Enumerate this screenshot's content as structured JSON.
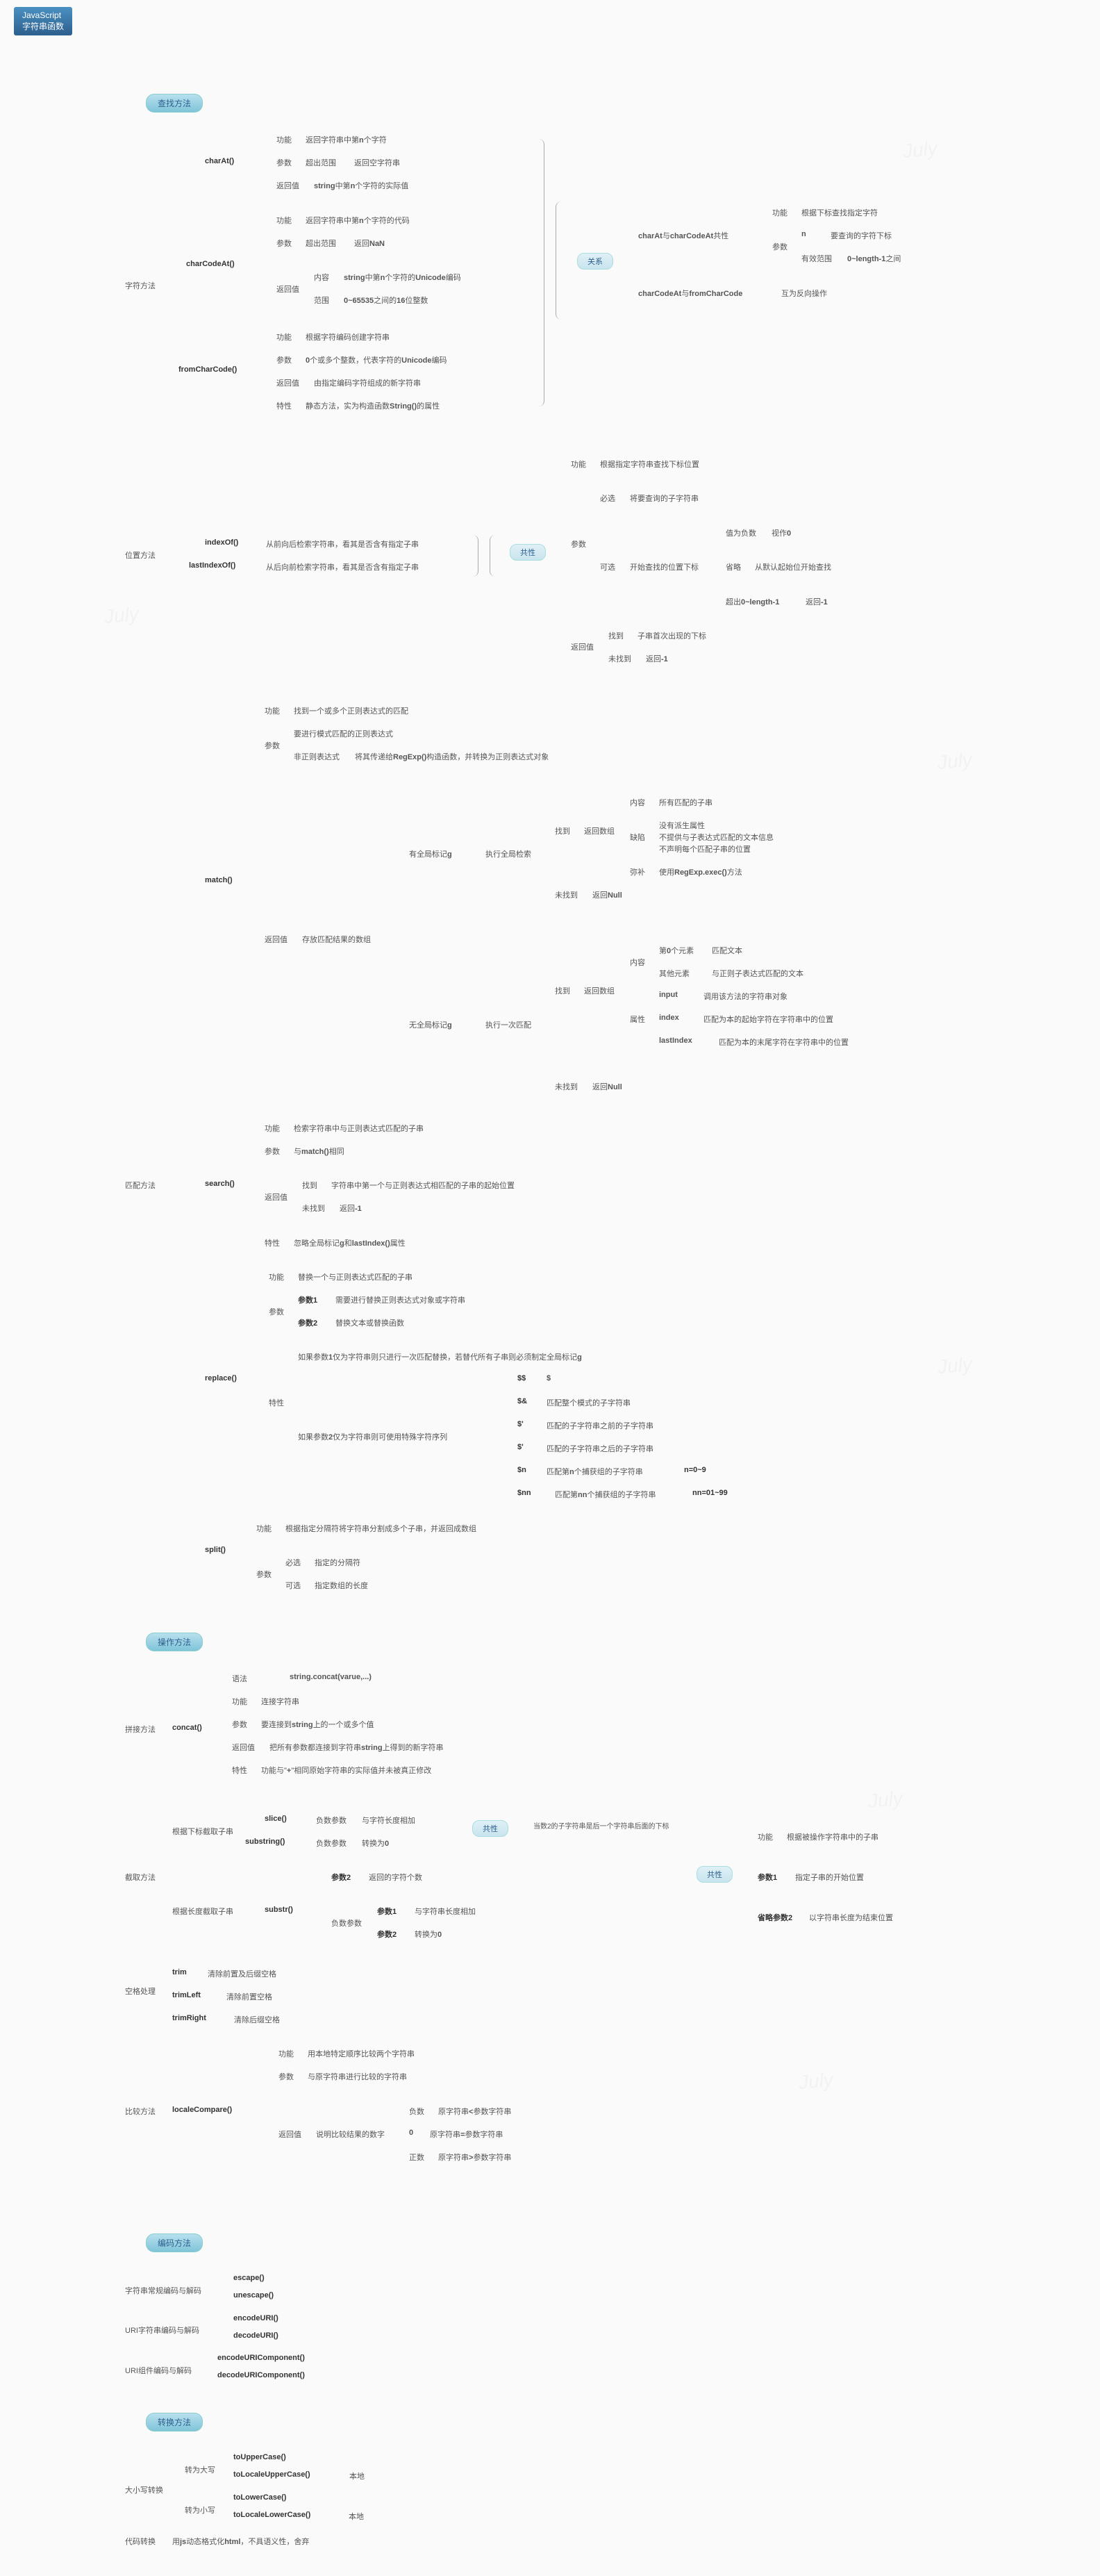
{
  "root": {
    "l1": "JavaScript",
    "l2": "字符串函数"
  },
  "s1": "查找方法",
  "s2": "操作方法",
  "s3": "编码方法",
  "s4": "转换方法",
  "cat": {
    "zf": "字符方法",
    "wz": "位置方法",
    "pp": "匹配方法",
    "pj": "拼接方法",
    "jq": "截取方法",
    "kg": "空格处理",
    "bj": "比较方法",
    "dx": "大小写转换",
    "dm": "代码转换"
  },
  "fn": {
    "charAt": "charAt()",
    "charCodeAt": "charCodeAt()",
    "fromCharCode": "fromCharCode()",
    "indexOf": "indexOf()",
    "lastIndexOf": "lastIndexOf()",
    "match": "match()",
    "search": "search()",
    "replace": "replace()",
    "split": "split()",
    "concat": "concat()",
    "slice": "slice()",
    "substring": "substring()",
    "substr": "substr()",
    "trim": "trim",
    "trimLeft": "trimLeft",
    "trimRight": "trimRight",
    "localeCompare": "localeCompare()",
    "escape": "escape()",
    "unescape": "unescape()",
    "encodeURI": "encodeURI()",
    "decodeURI": "decodeURI()",
    "encodeURIComponent": "encodeURIComponent()",
    "decodeURIComponent": "decodeURIComponent()",
    "toUpperCase": "toUpperCase()",
    "toLocaleUpperCase": "toLocaleUpperCase()",
    "toLowerCase": "toLowerCase()",
    "toLocaleLowerCase": "toLocaleLowerCase()"
  },
  "k": {
    "gn": "功能",
    "cs": "参数",
    "fhz": "返回值",
    "tx": "特性",
    "gx": "关系",
    "gxx": "共性",
    "bx": "必选",
    "kx": "可选",
    "zd": "找到",
    "wzd": "未找到",
    "nr": "内容",
    "fw": "范围",
    "yf": "语法",
    "qs": "缺陷",
    "mb": "弥补",
    "sx": "属性",
    "fs": "负数",
    "zs": "正数",
    "bd": "本地"
  },
  "t": {
    "ca_gn": "返回字符串中第<b>n</b>个字符",
    "ca_cs": "超出范围",
    "ca_cs2": "返回空字符串",
    "ca_fhz": "<b>string</b>中第<b>n</b>个字符的实际值",
    "cca_gn": "返回字符串中第<b>n</b>个字符的代码",
    "cca_cs": "超出范围",
    "cca_cs2": "返回<b>NaN</b>",
    "cca_nr": "<b>string</b>中第<b>n</b>个字符的<b>Unicode</b>编码",
    "cca_fw": "<b>0~65535</b>之间的<b>16</b>位整数",
    "fcc_gn": "根据字符编码创建字符串",
    "fcc_cs": "<b>0</b>个或多个整数，代表字符的<b>Unicode</b>编码",
    "fcc_fhz": "由指定编码字符组成的新字符串",
    "fcc_tx": "静态方法，实为构造函数<b>String()</b>的属性",
    "gx1": "<b>charAt</b>与<b>charCodeAt</b>共性",
    "gx2": "<b>charCodeAt</b>与<b>fromCharCode</b>",
    "gx_gn": "根据下标查找指定字符",
    "gx_n": "<b>n</b>",
    "gx_n2": "要查询的字符下标",
    "gx_yxfw": "有效范围",
    "gx_yxfw2": "<b>0~length-1</b>之间",
    "gx_hwfx": "互为反向操作",
    "io": "从前向后检索字符串，看其是否含有指定子串",
    "lio": "从后向前检索字符串，看其是否含有指定子串",
    "wz_gn": "根据指定字符串查找下标位置",
    "wz_bx": "将要查询的子字符串",
    "wz_zwfs": "值为负数",
    "wz_sz0": "视作<b>0</b>",
    "wz_sl": "省略",
    "wz_sl2": "从默认起始位开始查找",
    "wz_ks": "开始查找的位置下标",
    "wz_cc": "超出<b>0~length-1</b>",
    "wz_fh1": "返回<b>-1</b>",
    "wz_zd": "子串首次出现的下标",
    "wz_wzd": "返回<b>-1</b>",
    "m_gn": "找到一个或多个正则表达式的匹配",
    "m_cs1": "要进行模式匹配的正则表达式",
    "m_cs2": "非正则表达式",
    "m_cs3": "将其传递给<b>RegExp()</b>构造函数，并转换为正则表达式对象",
    "m_fhz": "存放匹配结果的数组",
    "m_g": "有全局标记<b>g</b>",
    "m_ng": "无全局标记<b>g</b>",
    "m_zxqj": "执行全局检索",
    "m_zxyc": "执行一次匹配",
    "m_fhsz": "返回数组",
    "m_fhnull": "返回<b>Null</b>",
    "m_nr": "所有匹配的子串",
    "m_qs1": "没有派生属性",
    "m_qs2": "不提供与子表达式匹配的文本信息",
    "m_qs3": "不声明每个匹配子串的位置",
    "m_mb": "使用<b>RegExp.exec()</b>方法",
    "m_d0": "第<b>0</b>个元素",
    "m_d0v": "匹配文本",
    "m_qt": "其他元素",
    "m_qtv": "与正则子表达式匹配的文本",
    "m_input": "<b>input</b>",
    "m_inputv": "调用该方法的字符串对象",
    "m_index": "<b>index</b>",
    "m_indexv": "匹配为本的起始字符在字符串中的位置",
    "m_last": "<b>lastIndex</b>",
    "m_lastv": "匹配为本的末尾字符在字符串中的位置",
    "se_gn": "检索字符串中与正则表达式匹配的子串",
    "se_cs": "与<b>match()</b>相同",
    "se_zd": "字符串中第一个与正则表达式相匹配的子串的起始位置",
    "se_wzd": "返回<b>-1</b>",
    "se_tx": "忽略全局标记<b>g</b>和<b>lastIndex()</b>属性",
    "re_gn": "替换一个与正则表达式匹配的子串",
    "re_cs1": "需要进行替换正则表达式对象或字符串",
    "re_cs1l": "参数1",
    "re_cs2": "替换文本或替换函数",
    "re_cs2l": "参数2",
    "re_tx1": "如果参数<b>1</b>仅为字符串则只进行一次匹配替换，若替代所有子串则必须制定全局标记<b>g</b>",
    "re_tx2": "如果参数<b>2</b>仅为字符串则可使用特殊字符序列",
    "re_dd": "$$",
    "re_ddv": "<b>$</b>",
    "re_da": "$&",
    "re_dav": "匹配整个模式的子字符串",
    "re_dp": "$'",
    "re_dpv": "匹配的子字符串之前的子字符串",
    "re_dn": "$'",
    "re_dnv": "匹配的子字符串之后的子字符串",
    "re_sn": "$n",
    "re_snv": "匹配第<b>n</b>个捕获组的子字符串",
    "re_snr": "n=0~9",
    "re_snn": "$nn",
    "re_snnv": "匹配第<b>nn</b>个捕获组的子字符串",
    "re_snnr": "nn=01~99",
    "sp_gn": "根据指定分隔符将字符串分割成多个子串，并返回成数组",
    "sp_bx": "指定的分隔符",
    "sp_kx": "指定数组的长度",
    "cc_yf": "<b>string.concat(varue,...)</b>",
    "cc_gn": "连接字符串",
    "cc_cs": "要连接到<b>string</b>上的一个或多个值",
    "cc_fhz": "把所有参数都连接到字符串<b>string</b>上得到的新字符串",
    "cc_tx": "功能与\"<b>+</b>\"相同原始字符串的实际值并未被真正修改",
    "jq_gj": "根据下标截取子串",
    "jq_cd": "根据长度截取子串",
    "jq_fscs": "负数参数",
    "jq_ycd": "与字符长度相加",
    "jq_zh0": "转换为<b>0</b>",
    "jq_gx1": "当数2的子字符串是后一个字符串后面的下标",
    "jq_cs2": "参数2",
    "jq_fh": "返回的字符个数",
    "jq_cs1": "参数1",
    "jq_cs1v": "与字符串长度相加",
    "jq_cs22": "参数2",
    "jq_cs2v": "转换为<b>0</b>",
    "jq_gn": "根据被操作字符串中的子串",
    "jq_p1": "参数1",
    "jq_p1v": "指定子串的开始位置",
    "jq_sl2": "省略参数2",
    "jq_sl2v": "以字符串长度为结束位置",
    "tr": "清除前置及后缀空格",
    "tl": "清除前置空格",
    "trr": "清除后缀空格",
    "lc_gn": "用本地特定顺序比较两个字符串",
    "lc_cs": "与原字符串进行比较的字符串",
    "lc_fhz": "说明比较结果的数字",
    "lc_fs": "原字符串<b><</b>参数字符串",
    "lc_0": "<b>0</b>",
    "lc_0v": "原字符串<b>=</b>参数字符串",
    "lc_zs": "原字符串<b>></b>参数字符串",
    "enc1": "字符串常规编码与解码",
    "enc2": "URI字符串编码与解码",
    "enc3": "URI组件编码与解码",
    "zd": "转为大写",
    "zx": "转为小写",
    "dmhtml": "用<b>js</b>动态格式化<b>html</b>，不具语义性，舍弃"
  }
}
